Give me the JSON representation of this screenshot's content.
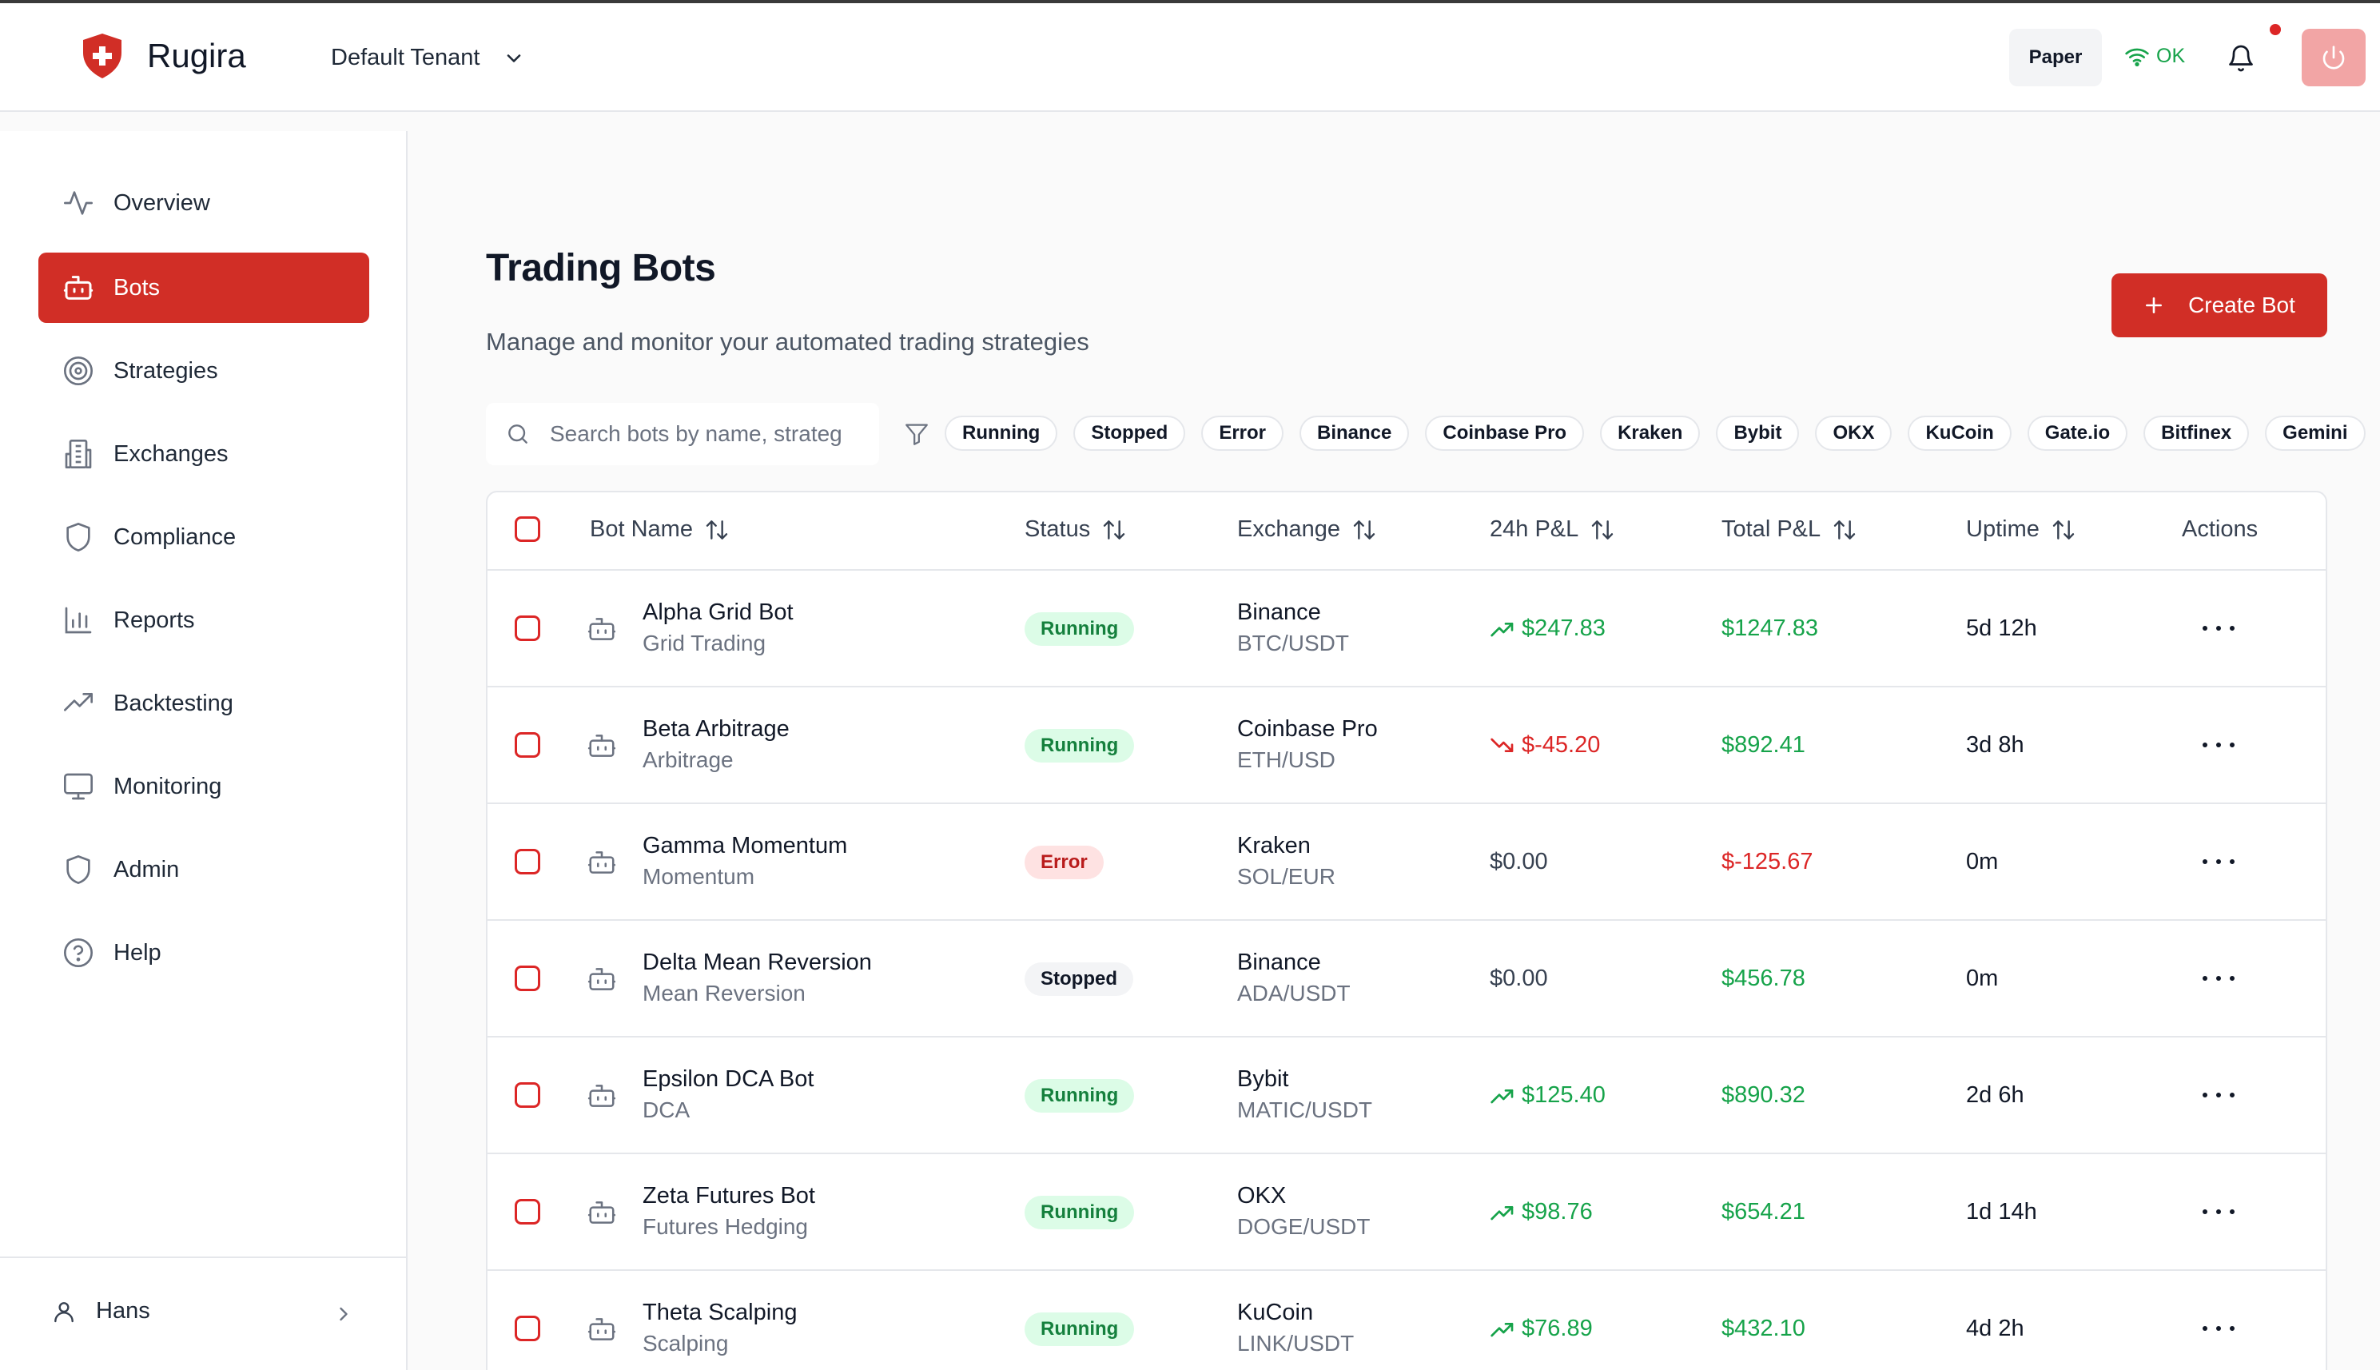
{
  "header": {
    "brand": "Rugira",
    "tenant": "Default Tenant",
    "mode": "Paper",
    "status": "OK"
  },
  "sidebar": {
    "items": [
      {
        "label": "Overview",
        "icon": "activity-icon"
      },
      {
        "label": "Bots",
        "icon": "bot-icon",
        "active": true
      },
      {
        "label": "Strategies",
        "icon": "target-icon"
      },
      {
        "label": "Exchanges",
        "icon": "building-icon"
      },
      {
        "label": "Compliance",
        "icon": "shield-icon"
      },
      {
        "label": "Reports",
        "icon": "bar-chart-icon"
      },
      {
        "label": "Backtesting",
        "icon": "trending-up-icon"
      },
      {
        "label": "Monitoring",
        "icon": "monitor-icon"
      },
      {
        "label": "Admin",
        "icon": "shield-icon"
      },
      {
        "label": "Help",
        "icon": "help-circle-icon"
      }
    ],
    "user": "Hans"
  },
  "main": {
    "title": "Trading Bots",
    "subtitle": "Manage and monitor your automated trading strategies",
    "create_label": "Create Bot",
    "search_placeholder": "Search bots by name, strateg",
    "filters": [
      "Running",
      "Stopped",
      "Error",
      "Binance",
      "Coinbase Pro",
      "Kraken",
      "Bybit",
      "OKX",
      "KuCoin",
      "Gate.io",
      "Bitfinex",
      "Gemini"
    ]
  },
  "table": {
    "columns": [
      "Bot Name",
      "Status",
      "Exchange",
      "24h P&L",
      "Total P&L",
      "Uptime",
      "Actions"
    ],
    "rows": [
      {
        "name": "Alpha Grid Bot",
        "strategy": "Grid Trading",
        "status": "Running",
        "exchange": "Binance",
        "pair": "BTC/USDT",
        "pnl24": "$247.83",
        "pnl24_trend": "up",
        "total": "$1247.83",
        "total_sign": "pos",
        "uptime": "5d 12h"
      },
      {
        "name": "Beta Arbitrage",
        "strategy": "Arbitrage",
        "status": "Running",
        "exchange": "Coinbase Pro",
        "pair": "ETH/USD",
        "pnl24": "$-45.20",
        "pnl24_trend": "down",
        "total": "$892.41",
        "total_sign": "pos",
        "uptime": "3d 8h"
      },
      {
        "name": "Gamma Momentum",
        "strategy": "Momentum",
        "status": "Error",
        "exchange": "Kraken",
        "pair": "SOL/EUR",
        "pnl24": "$0.00",
        "pnl24_trend": "flat",
        "total": "$-125.67",
        "total_sign": "neg",
        "uptime": "0m"
      },
      {
        "name": "Delta Mean Reversion",
        "strategy": "Mean Reversion",
        "status": "Stopped",
        "exchange": "Binance",
        "pair": "ADA/USDT",
        "pnl24": "$0.00",
        "pnl24_trend": "flat",
        "total": "$456.78",
        "total_sign": "pos",
        "uptime": "0m"
      },
      {
        "name": "Epsilon DCA Bot",
        "strategy": "DCA",
        "status": "Running",
        "exchange": "Bybit",
        "pair": "MATIC/USDT",
        "pnl24": "$125.40",
        "pnl24_trend": "up",
        "total": "$890.32",
        "total_sign": "pos",
        "uptime": "2d 6h"
      },
      {
        "name": "Zeta Futures Bot",
        "strategy": "Futures Hedging",
        "status": "Running",
        "exchange": "OKX",
        "pair": "DOGE/USDT",
        "pnl24": "$98.76",
        "pnl24_trend": "up",
        "total": "$654.21",
        "total_sign": "pos",
        "uptime": "1d 14h"
      },
      {
        "name": "Theta Scalping",
        "strategy": "Scalping",
        "status": "Running",
        "exchange": "KuCoin",
        "pair": "LINK/USDT",
        "pnl24": "$76.89",
        "pnl24_trend": "up",
        "total": "$432.10",
        "total_sign": "pos",
        "uptime": "4d 2h"
      }
    ]
  },
  "colors": {
    "accent": "#d12e26",
    "positive": "#16a34a",
    "negative": "#dc2626"
  }
}
